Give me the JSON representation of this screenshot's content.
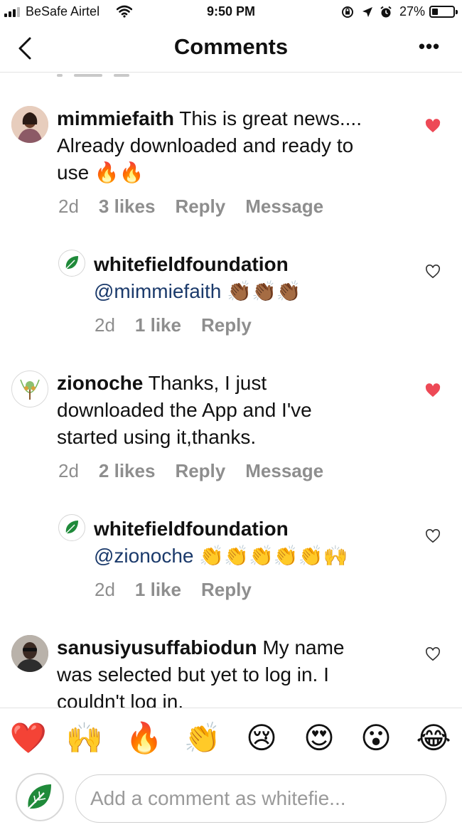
{
  "status_bar": {
    "carrier": "BeSafe Airtel",
    "time": "9:50 PM",
    "battery": "27%"
  },
  "header": {
    "title": "Comments",
    "more": "•••"
  },
  "comments": [
    {
      "username": "mimmiefaith",
      "text_lines": [
        "This is great news....",
        "Already downloaded and ready to",
        "use 🔥🔥"
      ],
      "time": "2d",
      "likes": "3 likes",
      "reply": "Reply",
      "message": "Message",
      "liked": true
    },
    {
      "username": "whitefieldfoundation",
      "mention": "@mimmiefaith",
      "emojis": "👏🏾👏🏾👏🏾",
      "time": "2d",
      "likes": "1 like",
      "reply": "Reply",
      "liked": false
    },
    {
      "username": "zionoche",
      "text_lines": [
        "Thanks, I just",
        "downloaded the App and I've",
        "started using it,thanks."
      ],
      "time": "2d",
      "likes": "2 likes",
      "reply": "Reply",
      "message": "Message",
      "liked": true
    },
    {
      "username": "whitefieldfoundation",
      "mention": "@zionoche",
      "emojis": "👏👏👏👏👏🙌",
      "time": "2d",
      "likes": "1 like",
      "reply": "Reply",
      "liked": false
    },
    {
      "username": "sanusiyusuffabiodun",
      "text_lines": [
        "My name",
        "was selected but yet to log in. I",
        "couldn't log in."
      ],
      "liked": false
    }
  ],
  "emoji_bar": [
    "❤️",
    "🙌",
    "🔥",
    "👏",
    "😢",
    "😍",
    "😮",
    "😂"
  ],
  "input": {
    "placeholder": "Add a comment as whitefie..."
  },
  "colors": {
    "like_red": "#ed4956",
    "mention_blue": "#1b3a6b",
    "meta_gray": "#8e8e8e",
    "brand_green": "#1f8a3a"
  }
}
